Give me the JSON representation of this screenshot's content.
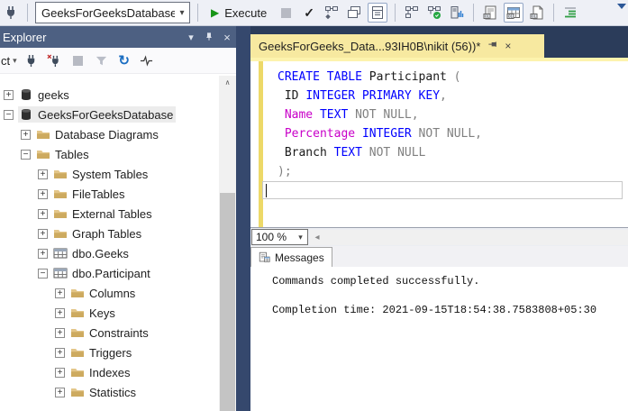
{
  "toolbar": {
    "database_selector": "GeeksForGeeksDatabase",
    "execute_label": "Execute"
  },
  "glyphs": {
    "dropdown": "▾",
    "close": "×",
    "check": "✓",
    "play": "▶",
    "refresh": "↻",
    "scroll_up": "∧",
    "scroll_left": "◂",
    "expand": "+",
    "collapse": "−"
  },
  "explorer": {
    "title": "Explorer",
    "connect_label": "ct",
    "tree": [
      {
        "label": "geeks",
        "level": 0,
        "toggle": "expand",
        "icon": "database"
      },
      {
        "label": "GeeksForGeeksDatabase",
        "level": 0,
        "toggle": "collapse",
        "icon": "database",
        "selected": true
      },
      {
        "label": "Database Diagrams",
        "level": 1,
        "toggle": "expand",
        "icon": "folder"
      },
      {
        "label": "Tables",
        "level": 1,
        "toggle": "collapse",
        "icon": "folder"
      },
      {
        "label": "System Tables",
        "level": 2,
        "toggle": "expand",
        "icon": "folder"
      },
      {
        "label": "FileTables",
        "level": 2,
        "toggle": "expand",
        "icon": "folder"
      },
      {
        "label": "External Tables",
        "level": 2,
        "toggle": "expand",
        "icon": "folder"
      },
      {
        "label": "Graph Tables",
        "level": 2,
        "toggle": "expand",
        "icon": "folder"
      },
      {
        "label": "dbo.Geeks",
        "level": 2,
        "toggle": "expand",
        "icon": "table"
      },
      {
        "label": "dbo.Participant",
        "level": 2,
        "toggle": "collapse",
        "icon": "table"
      },
      {
        "label": "Columns",
        "level": 3,
        "toggle": "expand",
        "icon": "folder"
      },
      {
        "label": "Keys",
        "level": 3,
        "toggle": "expand",
        "icon": "folder"
      },
      {
        "label": "Constraints",
        "level": 3,
        "toggle": "expand",
        "icon": "folder"
      },
      {
        "label": "Triggers",
        "level": 3,
        "toggle": "expand",
        "icon": "folder"
      },
      {
        "label": "Indexes",
        "level": 3,
        "toggle": "expand",
        "icon": "folder"
      },
      {
        "label": "Statistics",
        "level": 3,
        "toggle": "expand",
        "icon": "folder"
      }
    ]
  },
  "editor": {
    "tab_title": "GeeksForGeeks_Data...93IH0B\\nikit (56))*",
    "zoom_level": "100 %",
    "code_lines": [
      [
        [
          "CREATE TABLE ",
          "kw"
        ],
        [
          "Participant ",
          "plain"
        ],
        [
          "(",
          "op"
        ]
      ],
      [
        [
          " ID ",
          "plain"
        ],
        [
          "INTEGER PRIMARY KEY",
          "kw"
        ],
        [
          ",",
          "op"
        ]
      ],
      [
        [
          " ",
          "plain"
        ],
        [
          "Name",
          "sysfn"
        ],
        [
          " ",
          "plain"
        ],
        [
          "TEXT",
          "kw"
        ],
        [
          " NOT NULL,",
          "op"
        ]
      ],
      [
        [
          " ",
          "plain"
        ],
        [
          "Percentage",
          "sysfn"
        ],
        [
          " ",
          "plain"
        ],
        [
          "INTEGER",
          "kw"
        ],
        [
          " NOT NULL,",
          "op"
        ]
      ],
      [
        [
          " ",
          "plain"
        ],
        [
          "Branch",
          "plain"
        ],
        [
          " ",
          "plain"
        ],
        [
          "TEXT",
          "kw"
        ],
        [
          " NOT NULL",
          "op"
        ]
      ],
      [
        [
          ");",
          "op"
        ]
      ]
    ]
  },
  "results": {
    "tab_label": "Messages",
    "messages": [
      "Commands completed successfully.",
      "",
      "Completion time: 2021-09-15T18:54:38.7583808+05:30"
    ]
  },
  "colors": {
    "keyword": "#0000ff",
    "system_function": "#c800c8",
    "operator": "#808080",
    "plain_text": "#1a1a1a",
    "panel_title_bg": "#4d6082",
    "tab_strip_bg": "#2b3c5a",
    "active_tab_bg": "#f7e9a0",
    "splitter": "#35486d",
    "change_bar": "#edd968",
    "execute_green": "#169416"
  }
}
